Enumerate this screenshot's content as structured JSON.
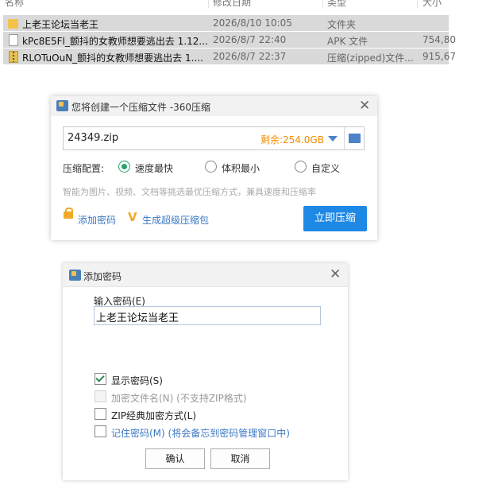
{
  "file_list": {
    "headers": {
      "name": "名称",
      "date": "修改日期",
      "type": "类型",
      "size": "大小"
    },
    "rows": [
      {
        "icon": "folder-icon",
        "name": "上老王论坛当老王",
        "date": "2026/8/10 10:05",
        "type": "文件夹",
        "size": ""
      },
      {
        "icon": "document-icon",
        "name": "kPc8E5Fl_颤抖的女教师想要逃出去 1.12...",
        "date": "2026/8/7 22:40",
        "type": "APK 文件",
        "size": "754,80"
      },
      {
        "icon": "zip-icon",
        "name": "RLOTuOuN_颤抖的女教师想要逃出去 1....",
        "date": "2026/8/7 22:37",
        "type": "压缩(zipped)文件...",
        "size": "915,67"
      }
    ]
  },
  "compress_dialog": {
    "title": "您将创建一个压缩文件 -360压缩",
    "filename": "24349.zip",
    "remaining": "剩余:254.0GB",
    "options_label": "压缩配置:",
    "options": [
      {
        "label": "速度最快",
        "selected": true
      },
      {
        "label": "体积最小",
        "selected": false
      },
      {
        "label": "自定义",
        "selected": false
      }
    ],
    "hint": "智能为图片、视频、文档等挑选最优压缩方式，兼具速度和压缩率",
    "add_password_link": "添加密码",
    "super_package_link": "生成超级压缩包",
    "compress_button": "立即压缩",
    "colors": {
      "primary": "#1e88e5",
      "remaining": "#f08c00",
      "radio_selected": "#29a36a"
    }
  },
  "password_dialog": {
    "title": "添加密码",
    "password_label": "输入密码(E)",
    "password_value": "上老王论坛当老王",
    "show_password": {
      "label": "显示密码(S)",
      "checked": true
    },
    "encrypt_filename": {
      "label": "加密文件名(N) (不支持ZIP格式)",
      "checked": false,
      "disabled": true
    },
    "zip_classic": {
      "label": "ZIP经典加密方式(L)",
      "checked": false
    },
    "remember": {
      "label": "记住密码(M) (将会备忘到密码管理窗口中)",
      "checked": false
    },
    "ok_button": "确认",
    "cancel_button": "取消"
  }
}
